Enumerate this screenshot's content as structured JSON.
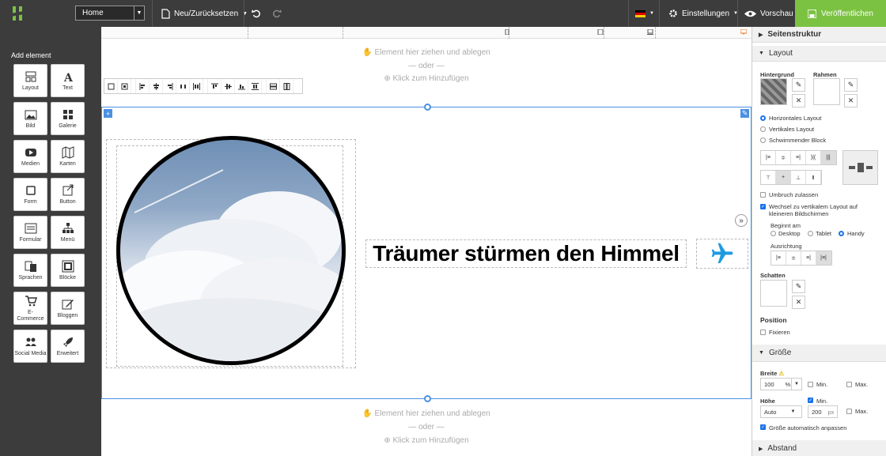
{
  "topbar": {
    "page": "Home",
    "new_reset": "Neu/Zurücksetzen",
    "settings": "Einstellungen",
    "preview": "Vorschau",
    "publish": "Veröffentlichen",
    "brand_color": "#7cc242"
  },
  "left": {
    "title": "Add element",
    "tiles": [
      {
        "label": "Layout",
        "icon": "layout-icon"
      },
      {
        "label": "Text",
        "icon": "text-icon"
      },
      {
        "label": "Bild",
        "icon": "image-icon"
      },
      {
        "label": "Galerie",
        "icon": "gallery-icon"
      },
      {
        "label": "Medien",
        "icon": "media-icon"
      },
      {
        "label": "Karten",
        "icon": "map-icon"
      },
      {
        "label": "Form",
        "icon": "form-icon"
      },
      {
        "label": "Button",
        "icon": "button-icon"
      },
      {
        "label": "Formular",
        "icon": "formular-icon"
      },
      {
        "label": "Menü",
        "icon": "menu-icon"
      },
      {
        "label": "Sprachen",
        "icon": "languages-icon"
      },
      {
        "label": "Blöcke",
        "icon": "blocks-icon"
      },
      {
        "label": "E-Commerce",
        "icon": "cart-icon"
      },
      {
        "label": "Bloggen",
        "icon": "blog-icon"
      },
      {
        "label": "Social Media",
        "icon": "social-icon"
      },
      {
        "label": "Erweitert",
        "icon": "rocket-icon"
      }
    ]
  },
  "canvas": {
    "drop": "Element hier ziehen und ablegen",
    "or": "— oder —",
    "click_add": "Klick zum Hinzufügen",
    "heading": "Träumer stürmen den Himmel",
    "accent": "#4a90e2",
    "plane_color": "#1e9be0"
  },
  "panel": {
    "structure": "Seitenstruktur",
    "layout": "Layout",
    "background": "Hintergrund",
    "frame": "Rahmen",
    "layout_options": [
      "Horizontales Layout",
      "Vertikales Layout",
      "Schwimmender Block"
    ],
    "wrap": "Umbruch zulassen",
    "switch_vertical": "Wechsel zu vertikalem Layout auf kleineren Bildschirmen",
    "starts_at": "Beginnt am",
    "devices": [
      "Desktop",
      "Tablet",
      "Handy"
    ],
    "alignment": "Ausrichtung",
    "shadow": "Schatten",
    "position": "Position",
    "fix": "Fixieren",
    "size": "Größe",
    "width": "Breite",
    "width_value": "100",
    "width_unit": "%",
    "min": "Min.",
    "max": "Max.",
    "height": "Höhe",
    "height_value": "Auto",
    "min_height_value": "200",
    "min_height_unit": "px",
    "auto_fit": "Größe automatisch anpassen",
    "spacing": "Abstand"
  }
}
